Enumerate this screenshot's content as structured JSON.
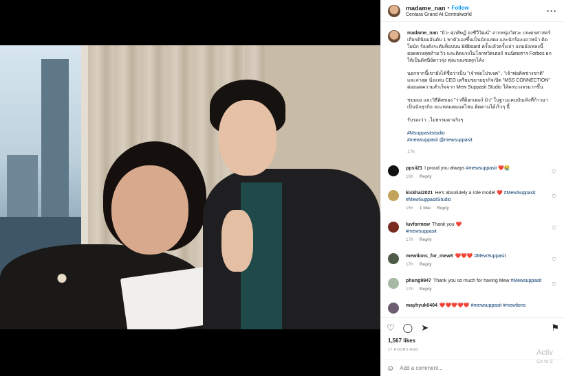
{
  "header": {
    "username": "madame_nan",
    "separator": "•",
    "follow_label": "Follow",
    "location": "Centara Grand At Centralworld",
    "more_icon": "more-horizontal-icon"
  },
  "caption": {
    "username": "madame_nan",
    "paragraphs": [
      "\"มิว- ศุภศิษฏ์ จงชีวีวัฒน์\" จากหนุ่มวิศวะ เกษตรศาสตร์ เกียรตินิยมอันดับ 1 พาตัวเองขึ้นเป็นนักแสดง และนักร้องแถวหน้า ติดโผนัก ร้องดังระดับท็อปบน Billboard ครั้งแล้วครั้งเล่า แถมยังเพลงนี้ยอดตรงสุดท้าย วิว และติดแรงในโลกทวิตเตอร์ จนนิตยสาร Forbes ยกให้เป็นดิสนีย์ดาวรุ่ง พุ่งแรงแซงทุกโค้ง",
      "นอกจากนี้เขายังได้ชื่อว่าเป็น \"เจ้าพ่อโปรเจค\" , \"เจ้าพ่อคิดช่างชาติ\" และล่าสุด นั่งแท่น CEO เตรียมขยายธุรกิจเปิด \"MSS CONNECTION\" ต่อยอดความสำเร็จจาก Mew Suppasit Studio ให้ครบวงจรมากขึ้น",
      "ชมมอง และวิธีคิดของ \"ว่าที่ด็อกเตอร์ มิว\" ในฐานะคนบันเทิงที่ก้าวมาเป็นนักธุรกิจ จะแหลมคมแค่ไหน ติดตามได้เร็วๆ นี้",
      "รับรองว่า...ไม่ธรรมดาจริงๆ"
    ],
    "hashtags": [
      "#Msuppasitstudio",
      "#mewsuppasit @mewsuppasit"
    ],
    "time": "17h"
  },
  "comments": [
    {
      "username": "ppsii21",
      "text": "I proud you always ",
      "tag": "#mewsuppasit",
      "emoji": "❤️😭",
      "time": "16h",
      "likes": "",
      "reply": "Reply",
      "avatar_color": "#111111"
    },
    {
      "username": "kiskhai2021",
      "text": "He's absolutely a role model ",
      "tag": "❤️ #MewSuppasit",
      "extra": "#MewSuppasitStudio",
      "time": "15h",
      "likes": "1 like",
      "reply": "Reply",
      "avatar_color": "#c2a35a"
    },
    {
      "username": "luvformew",
      "text": "Thank you ",
      "tag": "❤️",
      "extra": "#mewsuppasit",
      "time": "17h",
      "likes": "",
      "reply": "Reply",
      "avatar_color": "#7a2a1f"
    },
    {
      "username": "mewlions_for_mew8",
      "text": "❤️❤️❤️ ",
      "tag": "#MewSuppasit",
      "time": "17h",
      "likes": "",
      "reply": "Reply",
      "avatar_color": "#4d5b48"
    },
    {
      "username": "phung9947",
      "text": "Thank you so much for having Mew ",
      "tag": "#Mewsuppasit",
      "time": "17h",
      "likes": "",
      "reply": "Reply",
      "avatar_color": "#a7b9a3"
    },
    {
      "username": "mayhyuk0404",
      "text": "❤️❤️❤️❤️❤️ ",
      "tag": "#mewsuppasit #mewlions",
      "time": "",
      "likes": "",
      "reply": "",
      "avatar_color": "#6c5d70"
    }
  ],
  "actions": {
    "like_icon": "heart-icon",
    "comment_icon": "comment-icon",
    "share_icon": "share-icon",
    "save_icon": "bookmark-icon"
  },
  "likes": "1,567 likes",
  "posted_ago": "17 HOURS AGO",
  "add_comment": {
    "placeholder": "Add a comment..."
  },
  "watermark": {
    "line1": "Activ",
    "line2": "Go to S"
  }
}
